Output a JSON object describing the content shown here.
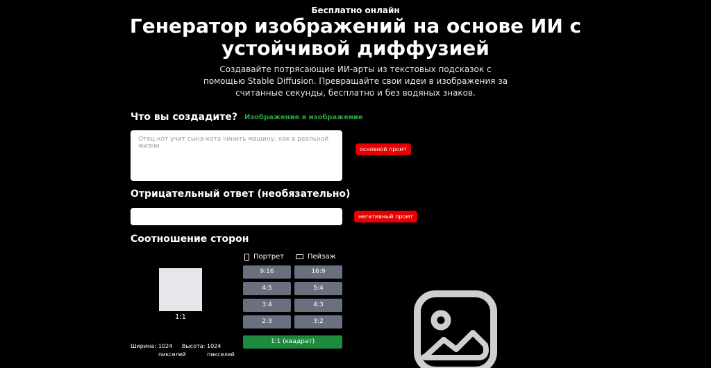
{
  "header": {
    "badge": "Бесплатно онлайн",
    "title": "Генератор изображений на основе ИИ с устойчивой диффузией",
    "subtitle": "Создавайте потрясающие ИИ-арты из текстовых подсказок с помощью Stable Diffusion. Превращайте свои идеи в изображения за считанные секунды, бесплатно и без водяных знаков."
  },
  "prompt": {
    "label": "Что вы создадите?",
    "img2img_link": "Изображение в изображение",
    "placeholder": "Отец-кот учит сына-кота чинить машину, как в реальной жизни",
    "tag": "основной промт"
  },
  "negative": {
    "label": "Отрицательный ответ (необязательно)",
    "value": "",
    "tag": "негативный промт"
  },
  "ratio": {
    "label": "Соотношение сторон",
    "preview": "1:1",
    "portrait_label": "Портрет",
    "landscape_label": "Пейзаж",
    "portrait_options": [
      "9:16",
      "4:5",
      "3:4",
      "2:3"
    ],
    "landscape_options": [
      "16:9",
      "5:4",
      "4:3",
      "3:2"
    ],
    "square": "1:1 (квадрат)",
    "width_label": "Ширина:",
    "width_value": "1024",
    "height_label": "Высота:",
    "height_value": "1024",
    "unit": "пикселей"
  },
  "colors": {
    "accent_green": "#1e8a3d",
    "tag_red": "#e60000",
    "button_gray": "#6b7080"
  },
  "icons": {
    "preview_placeholder": "image-icon"
  }
}
